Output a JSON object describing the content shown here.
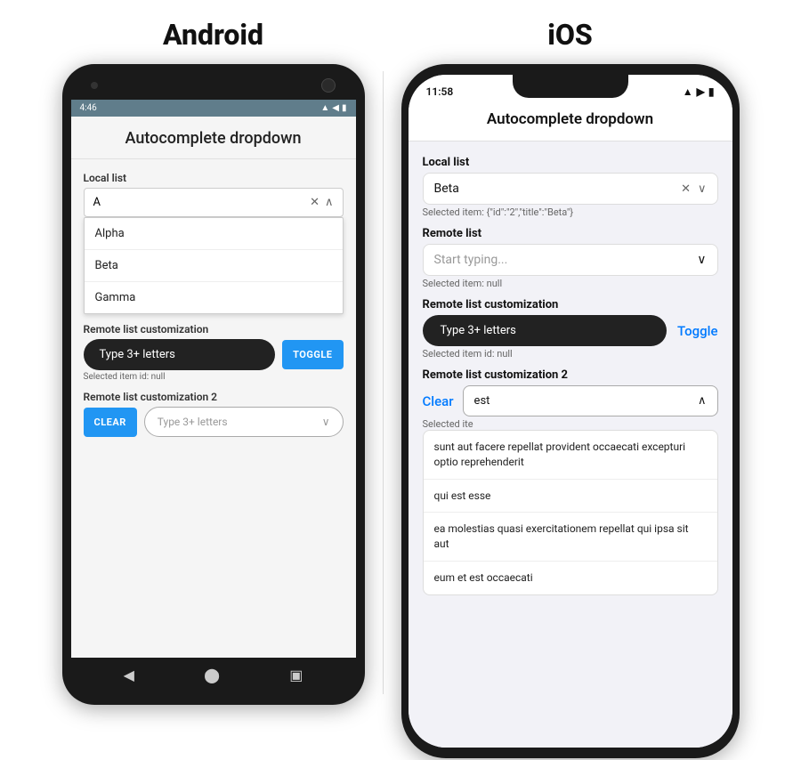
{
  "android": {
    "title": "Android",
    "status_time": "4:46",
    "status_icons": "▲◀",
    "app_title": "Autocomplete dropdown",
    "local_list_label": "Local list",
    "local_list_value": "A",
    "dropdown_items": [
      "Alpha",
      "Beta",
      "Gamma"
    ],
    "remote_customization_label": "Remote list customization",
    "type_placeholder": "Type 3+ letters",
    "toggle_label": "TOGGLE",
    "selected_item_id": "Selected item id: null",
    "remote2_label": "Remote list customization 2",
    "clear_label": "CLEAR",
    "type2_placeholder": "Type 3+ letters",
    "nav_back": "◀",
    "nav_home": "⬤",
    "nav_square": "▣"
  },
  "ios": {
    "title": "iOS",
    "status_time": "11:58",
    "status_wifi": "WiFi",
    "status_battery": "Battery",
    "app_title": "Autocomplete dropdown",
    "local_list_label": "Local list",
    "local_list_value": "Beta",
    "local_selected": "Selected item: {\"id\":\"2\",\"title\":\"Beta\"}",
    "remote_list_label": "Remote list",
    "remote_placeholder": "Start typing...",
    "remote_selected": "Selected item: null",
    "remote_customization_label": "Remote list customization",
    "type_placeholder": "Type 3+ letters",
    "toggle_label": "Toggle",
    "remote_selected_id": "Selected item id: null",
    "remote2_label": "Remote list customization 2",
    "clear_label": "Clear",
    "est_value": "est",
    "selected2_text": "Selected ite",
    "dropdown_items": [
      "sunt aut facere repellat provident occaecati excepturi optio reprehenderit",
      "qui est esse",
      "ea molestias quasi exercitationem repellat qui ipsa sit aut",
      "eum et est occaecati"
    ]
  }
}
